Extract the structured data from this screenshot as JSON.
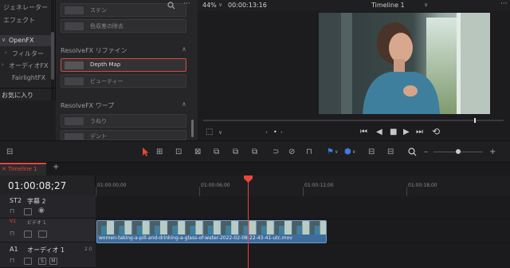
{
  "left_panel": {
    "items": [
      {
        "label": "ジェネレーター"
      },
      {
        "label": "エフェクト"
      },
      {
        "label": "OpenFX",
        "expanded": true
      },
      {
        "label": "フィルター"
      },
      {
        "label": "オーディオFX"
      },
      {
        "label": "FairlightFX"
      }
    ],
    "favorites": "お気に入り"
  },
  "effects": {
    "items_top": [
      {
        "label": "ステン"
      },
      {
        "label": "色収差の除去"
      }
    ],
    "group_refine": "ResolveFX リファイン",
    "depth_map": "Depth Map",
    "beauty": "ビューティー",
    "group_warp": "ResolveFX ワープ",
    "warp_items": [
      {
        "label": "うねり"
      },
      {
        "label": "デント"
      }
    ]
  },
  "viewer": {
    "zoom": "44%",
    "timecode": "00:00:13:16",
    "timeline_name": "Timeline 1",
    "chevron": "∨",
    "more": "···",
    "progress": 0.87
  },
  "transport": {
    "prev": "⏮",
    "back": "◀",
    "stop": "■",
    "play": "▶",
    "next": "⏭",
    "loop": "⟲"
  },
  "timeline": {
    "tab_label": "Timeline 1",
    "add_tab": "+",
    "current_timecode": "01:00:08;27",
    "ruler_labels": [
      "01:00:00;00",
      "01:00:06;00",
      "01:00:12;00",
      "01:00:18;00"
    ],
    "tracks": {
      "subtitle": {
        "id": "ST2",
        "name": "字幕 2"
      },
      "video": {
        "id": "V1",
        "name": "ビデオ 1"
      },
      "audio": {
        "id": "A1",
        "name": "オーディオ 1",
        "level": "2.0"
      }
    },
    "audio_buttons": {
      "solo": "S",
      "mute": "M"
    },
    "clip_name": "women-taking-a-pill-and-drinking-a-glass-of-water-2022-02-08-22-43-41-utc.mov"
  },
  "colors": {
    "accent_red": "#e8453c",
    "clip_blue": "#3e6d9b",
    "selected_border": "#d84a3d",
    "icon_blue": "#3d7ce0"
  }
}
